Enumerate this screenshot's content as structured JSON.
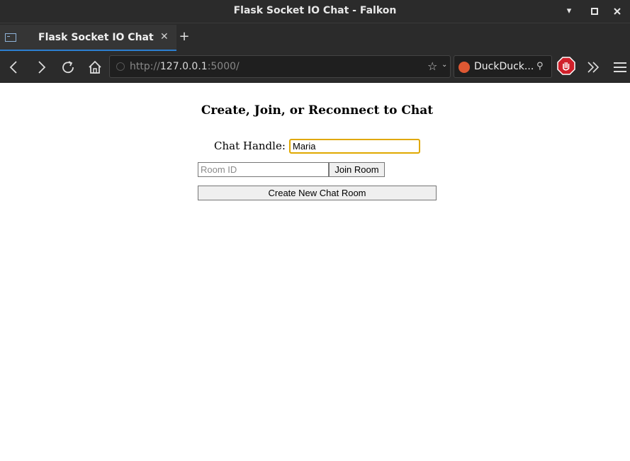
{
  "window": {
    "title": "Flask Socket IO Chat - Falkon",
    "controls": {
      "minimize": "minimize-icon",
      "maximize": "maximize-icon",
      "close": "close-icon"
    }
  },
  "tabs": [
    {
      "label": "Flask Socket IO Chat",
      "icon": "terminal-icon",
      "active": true
    }
  ],
  "toolbar": {
    "url_host": "127.0.0.1",
    "url_scheme": "http://",
    "url_port": ":5000/",
    "search_engine": "DuckDuck...",
    "icons": [
      "back-icon",
      "forward-icon",
      "reload-icon",
      "home-icon",
      "bookmark-star-icon",
      "adblock-icon",
      "overflow-icon",
      "menu-icon"
    ]
  },
  "page": {
    "heading": "Create, Join, or Reconnect to Chat",
    "handle_label": "Chat Handle:",
    "handle_value": "Maria",
    "room_placeholder": "Room ID",
    "join_button": "Join Room",
    "create_button": "Create New Chat Room"
  },
  "colors": {
    "chrome_bg": "#2b2b2b",
    "tab_accent": "#2d7fd0",
    "focus_border": "#e0a800",
    "adblock_red": "#d0202a"
  }
}
